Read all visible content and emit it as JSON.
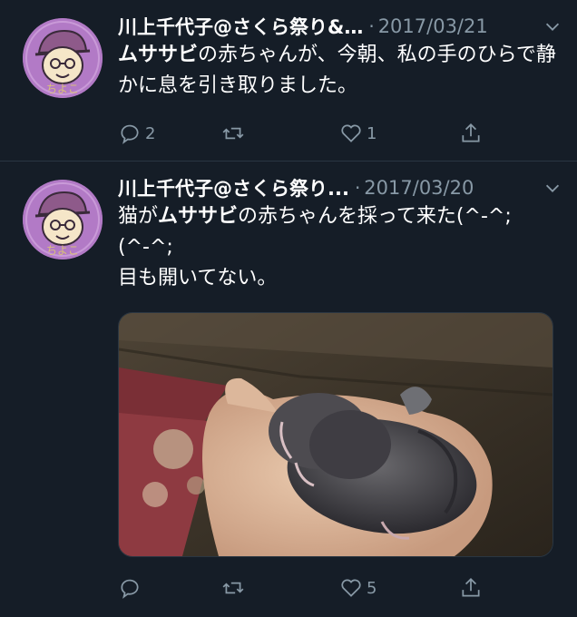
{
  "tweets": [
    {
      "author": "川上千代子@さくら祭り&…",
      "dot": "·",
      "date": "2017/03/21",
      "text_bold": "ムササビ",
      "text_rest": "の赤ちゃんが、今朝、私の手のひらで静かに息を引き取りました。",
      "reply_count": "2",
      "retweet_count": "",
      "like_count": "1",
      "avatar_text": "ちよこ"
    },
    {
      "author": "川上千代子@さくら祭り...",
      "dot": "·",
      "date": "2017/03/20",
      "text_pre": "猫が",
      "text_bold": "ムササビ",
      "text_mid": "の赤ちゃんを採って来た(^-^;",
      "text_line2": "(^-^;",
      "text_line3": "目も開いてない。",
      "reply_count": "",
      "retweet_count": "",
      "like_count": "5",
      "avatar_text": "ちよこ"
    }
  ],
  "colors": {
    "background": "#151d27",
    "secondary_text": "#8899a6",
    "divider": "#2a3642",
    "avatar_bg": "#b27ac6"
  }
}
